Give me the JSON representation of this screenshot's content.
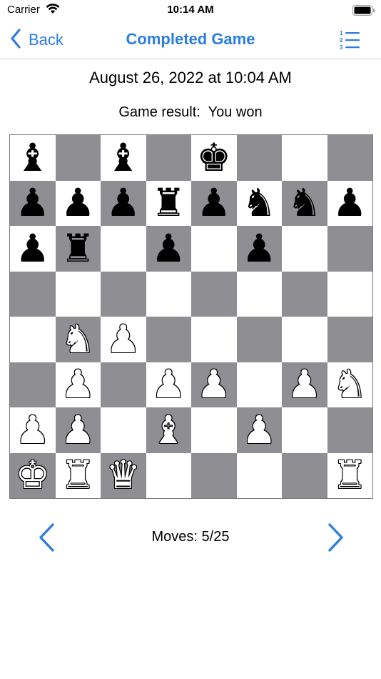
{
  "status_bar": {
    "carrier": "Carrier",
    "time": "10:14 AM"
  },
  "nav": {
    "back_label": "Back",
    "title": "Completed Game",
    "accent_color": "#2c7de0"
  },
  "game": {
    "date": "August 26, 2022 at 10:04 AM",
    "result": "Game result:  You won",
    "moves": "Moves: 5/25"
  },
  "board": {
    "light_color": "#ffffff",
    "dark_color": "#8e8e93",
    "rows": [
      [
        "bB",
        "",
        "bB",
        "",
        "bK",
        "",
        "",
        ""
      ],
      [
        "bP",
        "bP",
        "bP",
        "bR",
        "bP",
        "bN",
        "bN",
        "bP"
      ],
      [
        "bP",
        "bR",
        "",
        "bP",
        "",
        "bP",
        "",
        ""
      ],
      [
        "",
        "",
        "",
        "",
        "",
        "",
        "",
        ""
      ],
      [
        "",
        "wN",
        "wP",
        "",
        "",
        "",
        "",
        ""
      ],
      [
        "",
        "wP",
        "",
        "wP",
        "wP",
        "",
        "wP",
        "wN"
      ],
      [
        "wP",
        "wP",
        "",
        "wB",
        "",
        "wP",
        "",
        ""
      ],
      [
        "wK",
        "wR",
        "wQ",
        "",
        "",
        "",
        "",
        "wR"
      ]
    ]
  }
}
